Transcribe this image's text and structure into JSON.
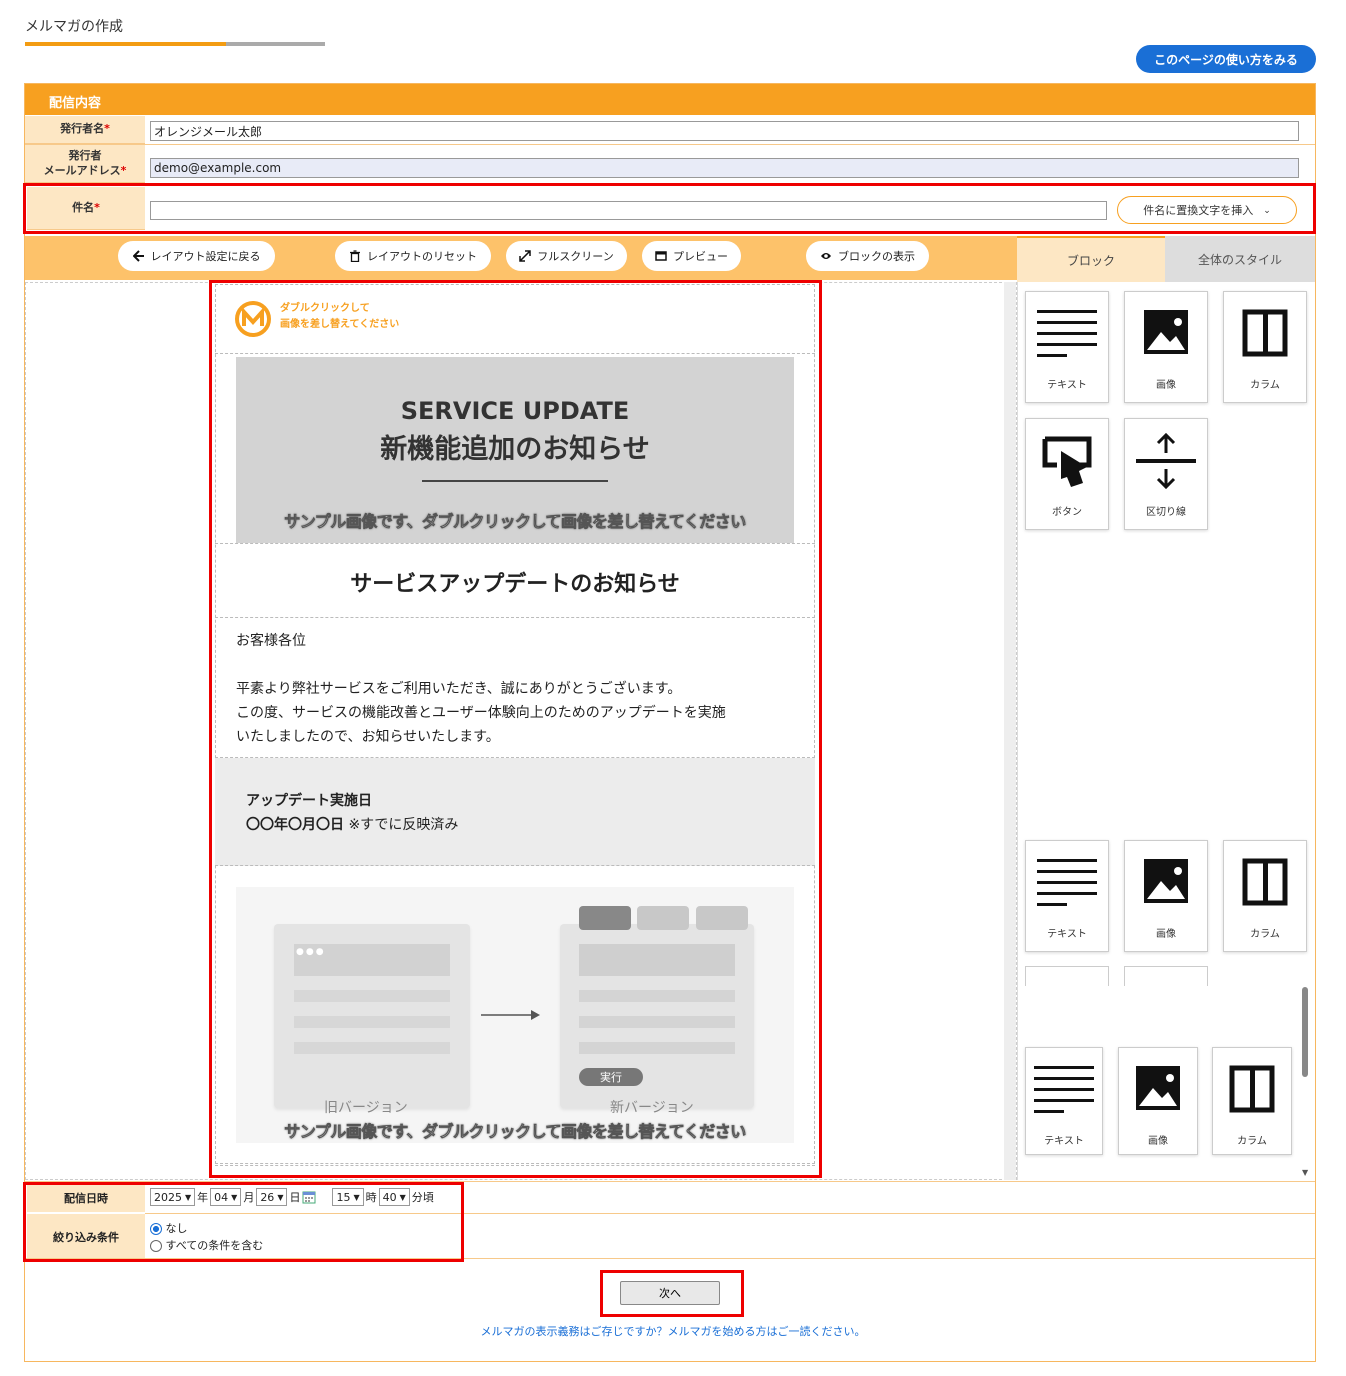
{
  "page": {
    "title": "メルマガの作成",
    "progress": 0.67,
    "help_button": "このページの使い方をみる"
  },
  "form": {
    "section_title": "配信内容",
    "sender_name_label": "発行者名",
    "sender_name_value": "オレンジメール太郎",
    "sender_email_label_1": "発行者",
    "sender_email_label_2": "メールアドレス",
    "sender_email_value": "demo@example.com",
    "subject_label": "件名",
    "subject_value": "",
    "insert_button": "件名に置換文字を挿入",
    "required_mark": "*"
  },
  "toolbar": {
    "back": "レイアウト設定に戻る",
    "reset": "レイアウトのリセット",
    "fullscreen": "フルスクリーン",
    "preview": "プレビュー",
    "show_blocks": "ブロックの表示"
  },
  "side_panel": {
    "tabs": [
      "ブロック",
      "全体のスタイル"
    ],
    "tiles": [
      "テキスト",
      "画像",
      "カラム",
      "ボタン",
      "区切り線"
    ]
  },
  "email": {
    "logo_text_1": "ダブルクリックして",
    "logo_text_2": "画像を差し替えてください",
    "hero_en": "SERVICE UPDATE",
    "hero_jp": "新機能追加のお知らせ",
    "sample_caption": "サンプル画像です、ダブルクリックして画像を差し替えてください",
    "heading": "サービスアップデートのお知らせ",
    "greeting": "お客様各位",
    "body_1": "平素より弊社サービスをご利用いただき、誠にありがとうございます。",
    "body_2": "この度、サービスの機能改善とユーザー体験向上のためのアップデートを実施",
    "body_3": "いたしましたので、お知らせいたします。",
    "date_title": "アップデート実施日",
    "date_value": "〇〇年〇月〇日",
    "date_note": "※すでに反映済み",
    "old_version": "旧バージョン",
    "new_version": "新バージョン",
    "run_label": "実行"
  },
  "schedule": {
    "label": "配信日時",
    "year": "2025",
    "year_unit": "年",
    "month": "04",
    "month_unit": "月",
    "day": "26",
    "day_unit": "日",
    "hour": "15",
    "hour_unit": "時",
    "minute": "40",
    "minute_unit": "分頃"
  },
  "filter": {
    "label": "絞り込み条件",
    "option_none": "なし",
    "option_all": "すべての条件を含む"
  },
  "footer": {
    "next": "次へ",
    "link": "メルマガの表示義務はご存じですか？メルマガを始める方はご一読ください。"
  }
}
